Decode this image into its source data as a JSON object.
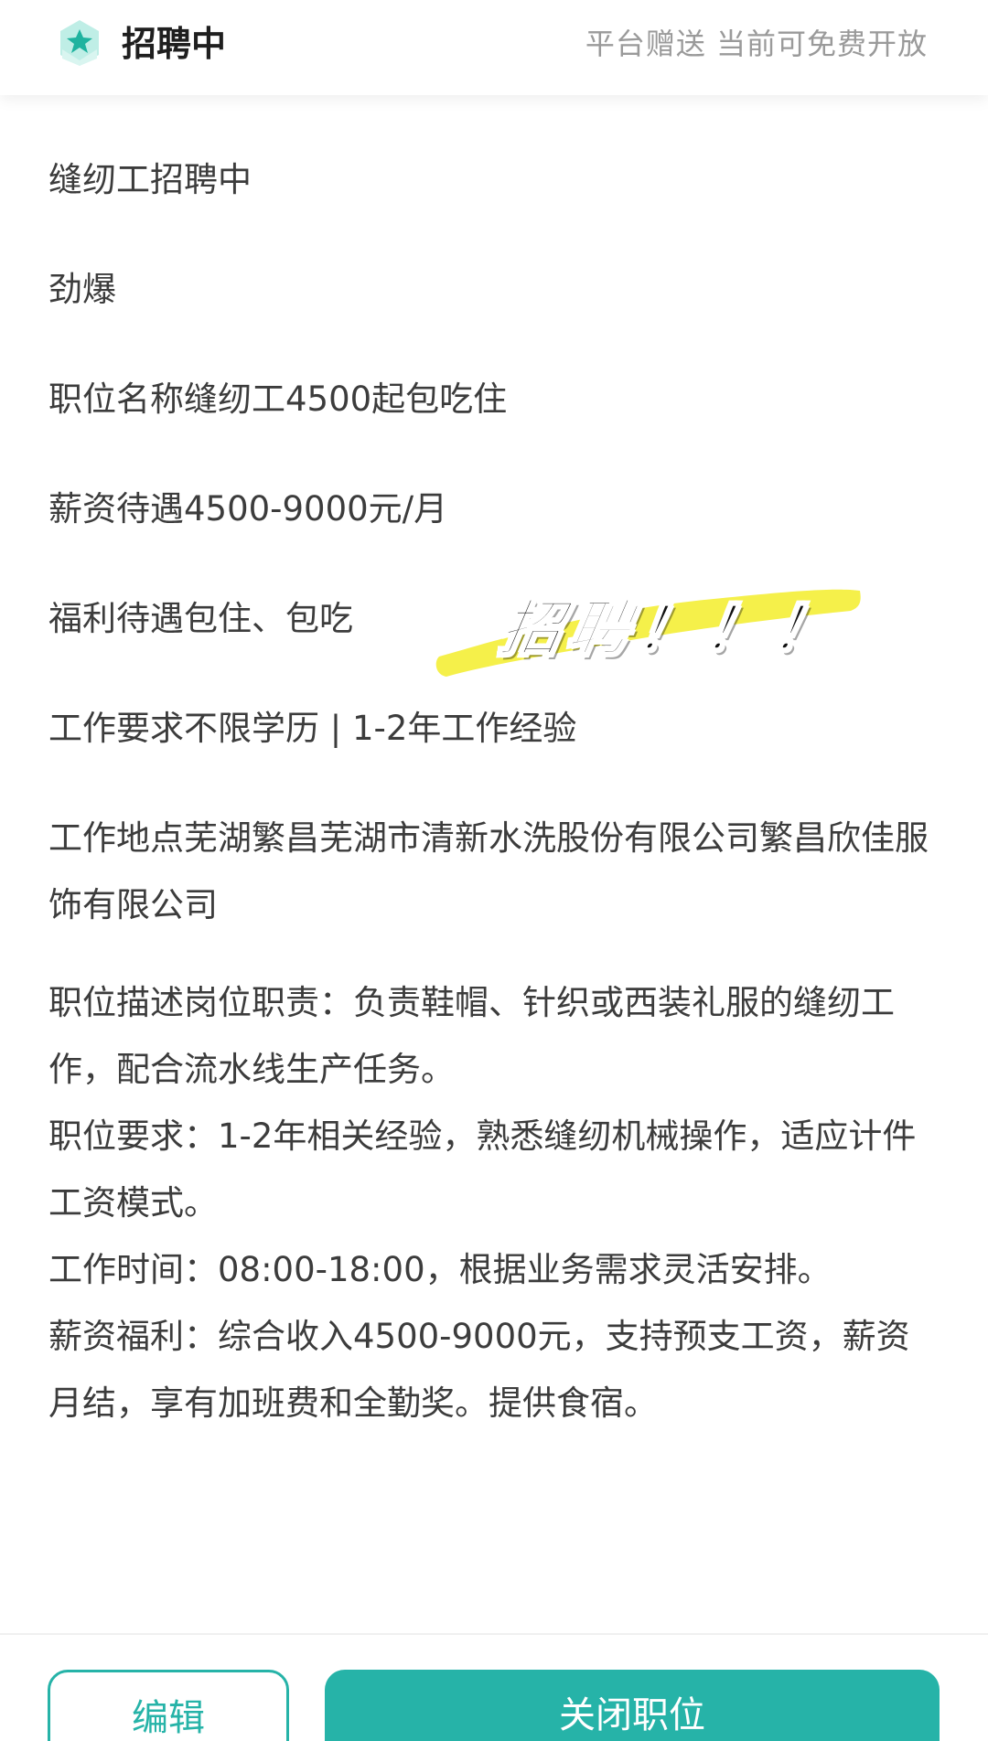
{
  "header": {
    "title": "招聘中",
    "note": "平台赠送 当前可免费开放",
    "logo_icon": "star-envelope-icon",
    "accent_color": "#26b3a8"
  },
  "job": {
    "line1": "缝纫工招聘中",
    "line2": "劲爆",
    "line3": "职位名称缝纫工4500起包吃住",
    "line4": "薪资待遇4500-9000元/月",
    "line5": "福利待遇包住、包吃",
    "line6": "工作要求不限学历 | 1-2年工作经验",
    "location": "工作地点芜湖繁昌芜湖市清新水洗股份有限公司繁昌欣佳服饰有限公司",
    "description": "职位描述岗位职责：负责鞋帽、针织或西装礼服的缝纫工作，配合流水线生产任务。",
    "requirements": "职位要求：1-2年相关经验，熟悉缝纫机械操作，适应计件工资模式。",
    "work_time": "工作时间：08:00-18:00，根据业务需求灵活安排。",
    "salary_benefits": "薪资福利：综合收入4500-9000元，支持预支工资，薪资月结，享有加班费和全勤奖。提供食宿。"
  },
  "sticker": {
    "text": "招聘！！！",
    "highlight_color": "#f5f04a"
  },
  "buttons": {
    "edit": "编辑",
    "close": "关闭职位"
  }
}
